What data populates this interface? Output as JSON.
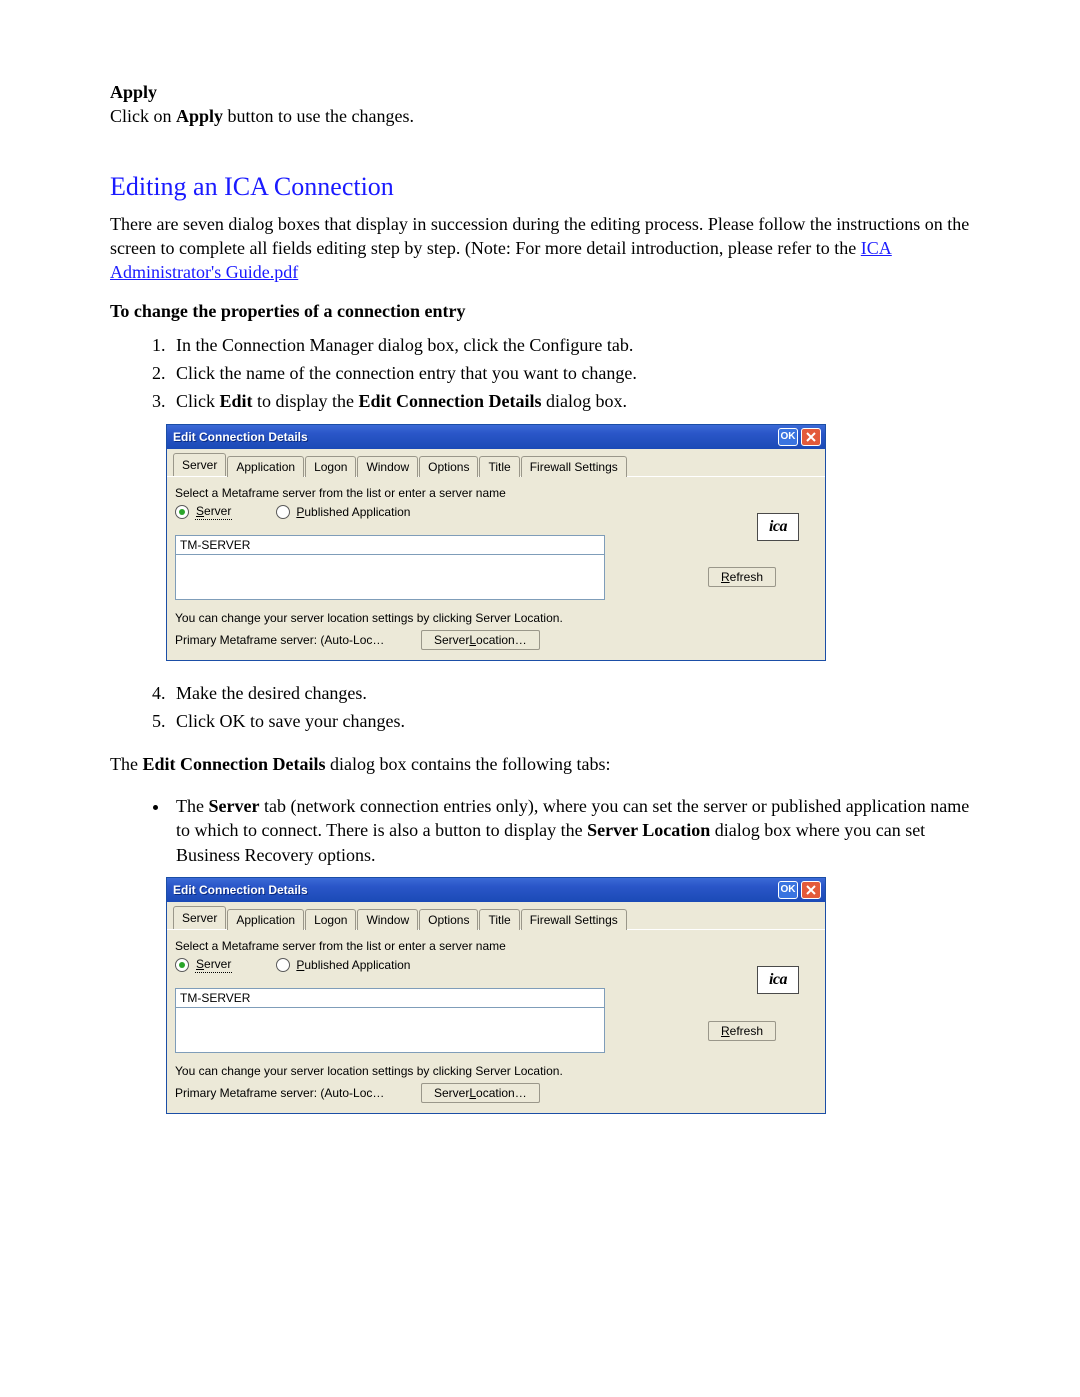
{
  "apply": {
    "heading": "Apply",
    "text_before": "Click on ",
    "text_bold": "Apply",
    "text_after": " button to use the changes."
  },
  "section": {
    "title": "Editing an ICA Connection",
    "intro_before_link": "There are seven dialog boxes that display in succession during the editing process. Please follow the instructions on the screen to complete all fields editing step by step. (Note: For more detail introduction, please refer to the ",
    "link_text": "ICA Administrator's Guide.pdf",
    "subhead": "To change the properties of a connection entry"
  },
  "steps_a": {
    "1": "In the Connection Manager dialog box, click the Configure tab.",
    "2": "Click the name of the connection entry that you want to change.",
    "3_pre": "Click ",
    "3_b1": "Edit",
    "3_mid": " to display the ",
    "3_b2": "Edit Connection Details",
    "3_post": " dialog box."
  },
  "steps_b": {
    "4": "Make the desired changes.",
    "5": "Click OK to save your changes."
  },
  "tabs_line": {
    "pre": "The ",
    "b": "Edit Connection Details",
    "post": " dialog box contains the following tabs:"
  },
  "bullet": {
    "pre": "The ",
    "b1": "Server",
    "mid1": " tab (network connection entries only), where you can set the server or published application name to which to connect. There is also a button to display the ",
    "b2": "Server Location",
    "post": " dialog box where you can set Business Recovery options."
  },
  "dialog": {
    "title": "Edit Connection Details",
    "ok": "OK",
    "tabs": {
      "0": "Server",
      "1": "Application",
      "2": "Logon",
      "3": "Window",
      "4": "Options",
      "5": "Title",
      "6": "Firewall Settings"
    },
    "instr": "Select a Metaframe server from the list or enter a server name",
    "radio_server_u": "S",
    "radio_server_rest": "erver",
    "radio_pub_u": "P",
    "radio_pub_rest": "ublished Application",
    "logo": "ica",
    "combo_value": "TM-SERVER",
    "refresh_u": "R",
    "refresh_rest": "efresh",
    "hint": "You can change your server location settings by clicking Server Location.",
    "primary": "Primary Metaframe server: (Auto-Loc…",
    "serverloc_pre": "Server ",
    "serverloc_u": "L",
    "serverloc_rest": "ocation…"
  }
}
